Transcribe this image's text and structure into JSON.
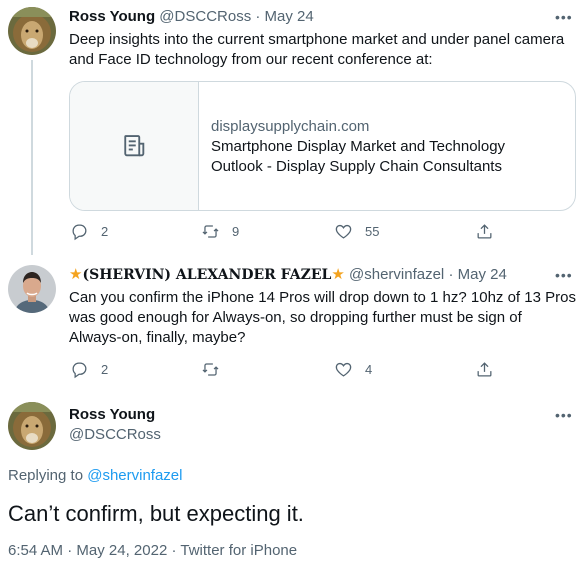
{
  "tweet1": {
    "name": "Ross Young",
    "handle": "@DSCCRoss",
    "sep": "·",
    "date": "May 24",
    "more": "•••",
    "text_line1": "Deep insights into the current smartphone market and under panel camera",
    "text_line2": "and Face ID technology from our recent conference at:",
    "card": {
      "domain": "displaysupplychain.com",
      "title_line1": "Smartphone Display Market and Technology",
      "title_line2": "Outlook - Display Supply Chain Consultants",
      "icon": "document-icon"
    },
    "actions": {
      "replies": "2",
      "retweets": "9",
      "likes": "55"
    }
  },
  "tweet2": {
    "name_prefix": "(SHERVIN) ALEXANDER FAZEL",
    "handle": "@shervinfazel",
    "sep": "·",
    "date": "May 24",
    "more": "•••",
    "text_line1": "Can you confirm the iPhone 14 Pros will drop down to 1 hz? 10hz of 13 Pros",
    "text_line2": "was good enough for Always-on, so dropping further must be sign of",
    "text_line3": "Always-on, finally, maybe?",
    "actions": {
      "replies": "2",
      "retweets": "",
      "likes": "4"
    }
  },
  "main": {
    "name": "Ross Young",
    "handle": "@DSCCRoss",
    "more": "•••",
    "replying_label": "Replying to",
    "replying_handle": "@shervinfazel",
    "text": "Can’t confirm, but expecting it.",
    "time": "6:54 AM",
    "sep": "·",
    "date": "May 24, 2022",
    "source": "Twitter for iPhone"
  },
  "colors": {
    "link": "#1d9bf0",
    "muted": "#536471",
    "border": "#cfd9de",
    "text": "#0f1419",
    "star": "#f4a31f"
  }
}
